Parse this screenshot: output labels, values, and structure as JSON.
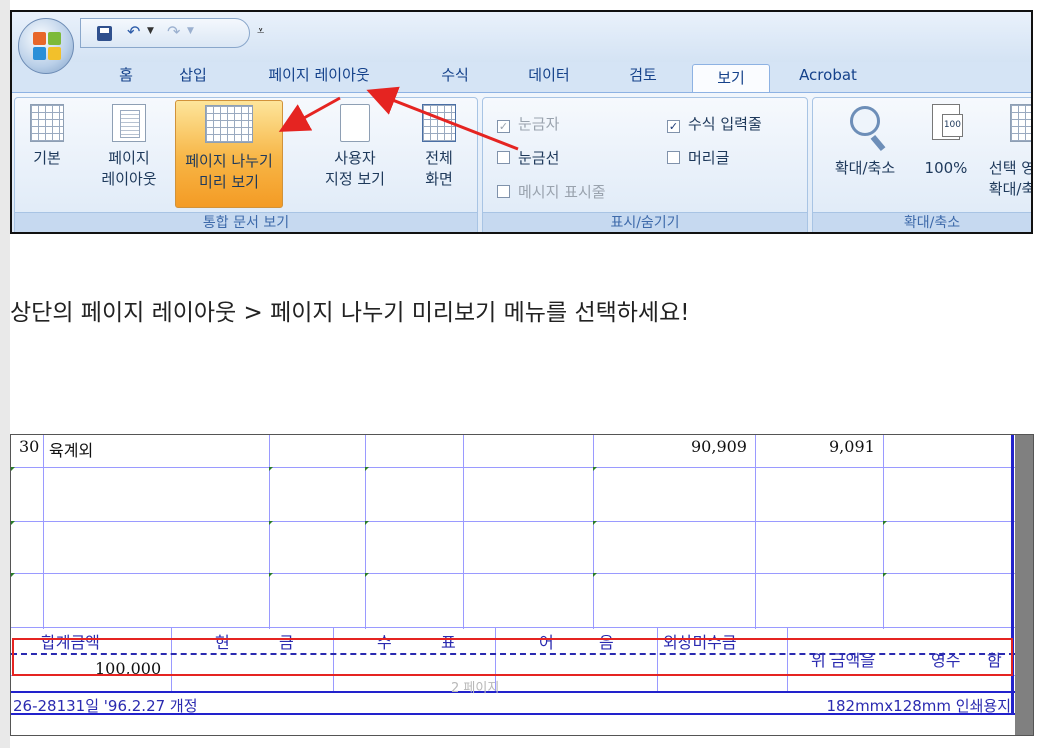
{
  "ribbon": {
    "tabs": [
      {
        "label": "홈",
        "active": false
      },
      {
        "label": "삽입",
        "active": false
      },
      {
        "label": "페이지 레이아웃",
        "active": false
      },
      {
        "label": "수식",
        "active": false
      },
      {
        "label": "데이터",
        "active": false
      },
      {
        "label": "검토",
        "active": false
      },
      {
        "label": "보기",
        "active": true
      },
      {
        "label": "Acrobat",
        "active": false
      }
    ],
    "workbook_views": {
      "group_label": "통합 문서 보기",
      "normal": "기본",
      "page_layout_1": "페이지",
      "page_layout_2": "레이아웃",
      "page_break_1": "페이지 나누기",
      "page_break_2": "미리 보기",
      "custom_1": "사용자",
      "custom_2": "지정 보기",
      "full_1": "전체",
      "full_2": "화면"
    },
    "show_hide": {
      "group_label": "표시/숨기기",
      "ruler": {
        "label": "눈금자",
        "checked": true,
        "enabled": false
      },
      "formula_bar": {
        "label": "수식 입력줄",
        "checked": true,
        "enabled": true
      },
      "gridlines": {
        "label": "눈금선",
        "checked": false,
        "enabled": true
      },
      "headings": {
        "label": "머리글",
        "checked": false,
        "enabled": true
      },
      "message_bar": {
        "label": "메시지 표시줄",
        "checked": false,
        "enabled": false
      }
    },
    "zoom": {
      "group_label": "확대/축소",
      "zoom": "확대/축소",
      "hundred": "100%",
      "hundred_icon": "100",
      "selection_1": "선택 영",
      "selection_2": "확대/축"
    },
    "arrow_color": "#e52421"
  },
  "instruction": "상단의 페이지 레이아웃 > 페이지 나누기 미리보기 메뉴를 선택하세요!",
  "sheet": {
    "row_number": "30",
    "row_label": "육계외",
    "amount1": "90,909",
    "amount2": "9,091",
    "summary_headers": [
      "합계금액",
      "현",
      "금",
      "수",
      "표",
      "어",
      "음",
      "외상미수금"
    ],
    "receipt_text": "위 금액을",
    "receipt_word": "영수",
    "receipt_end": "함",
    "total": "100,000",
    "page_label": "2 페이지",
    "footer_left": "26-28131일 '96.2.27 개정",
    "footer_right": "182mmx128mm 인쇄용지",
    "break_line_color": "#2a2ab0",
    "highlight_color": "#e52421"
  }
}
